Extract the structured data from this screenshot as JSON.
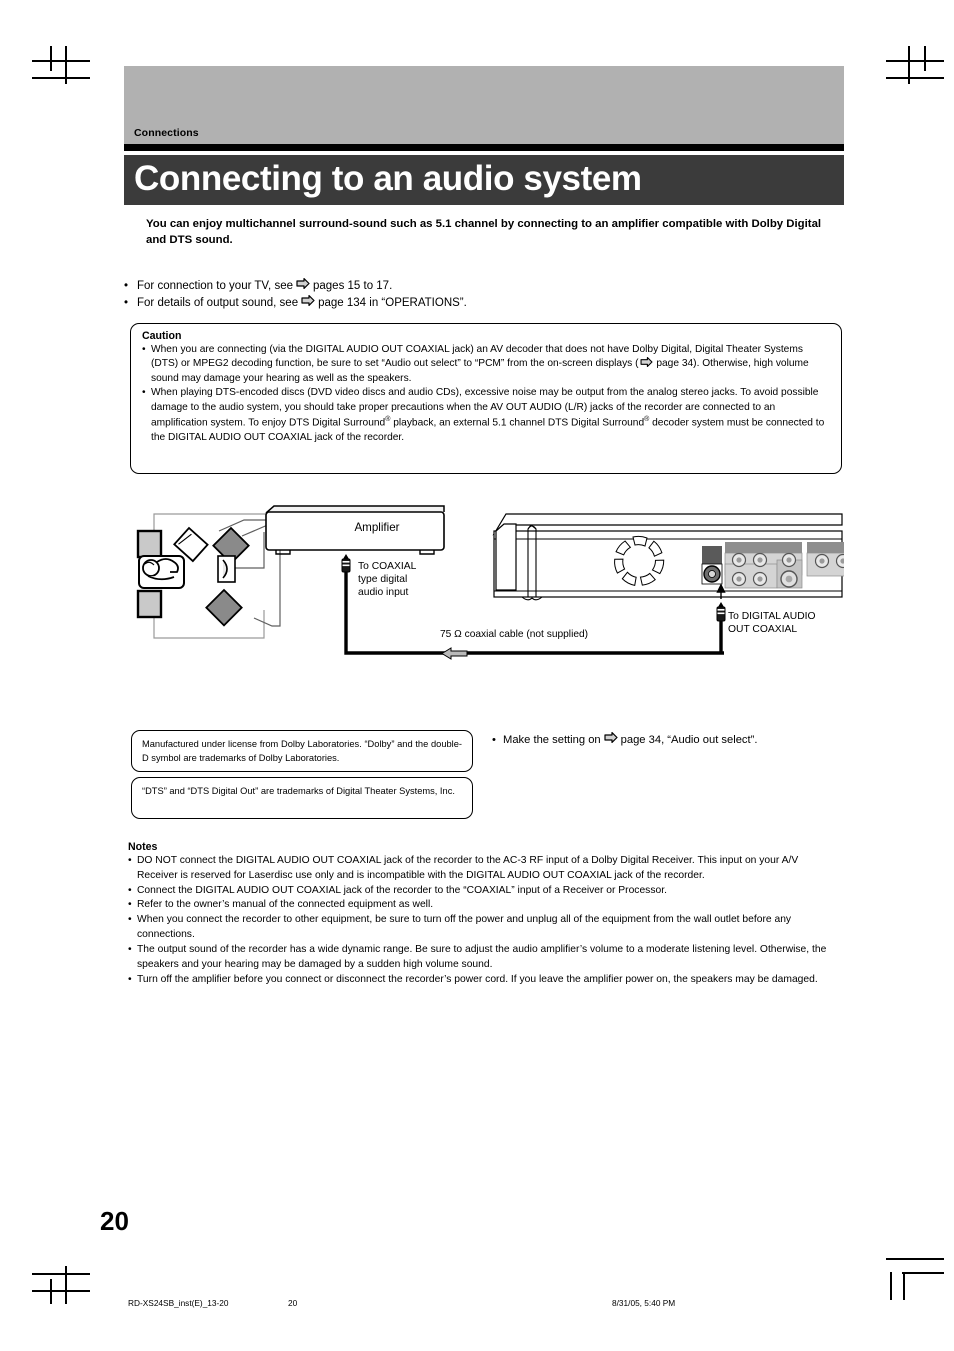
{
  "header": {
    "section_label": "Connections",
    "title": "Connecting to an audio system"
  },
  "intro": "You can enjoy multichannel surround-sound such as 5.1 channel by connecting to an amplifier compatible with Dolby Digital and DTS sound.",
  "see_also": [
    {
      "bullet": "•",
      "before": "For connection to your TV, see",
      "after": "pages 15 to 17."
    },
    {
      "bullet": "•",
      "before": "For details of output sound, see",
      "after": "page 134 in “OPERATIONS”."
    }
  ],
  "caution": {
    "heading": "Caution",
    "items": [
      {
        "bullet": "•",
        "part1": "When you are connecting (via the DIGITAL AUDIO OUT COAXIAL jack) an AV decoder that does not have Dolby Digital, Digital Theater Systems (DTS) or MPEG2 decoding function, be sure to set “Audio out select” to “PCM” from the on-screen displays (",
        "part2": " page 34). Otherwise, high volume sound may damage your hearing as well as the speakers."
      },
      {
        "bullet": "•",
        "part1": "When playing DTS-encoded discs (DVD video discs and audio CDs), excessive noise may be output from the analog stereo jacks.  To avoid possible damage to the audio system, you should take proper precautions when the AV OUT AUDIO (L/R) jacks of the recorder are connected to an amplification system.  To enjoy DTS Digital Surround® playback, an external 5.1 channel DTS Digital Surround® decoder system must be connected to the DIGITAL AUDIO OUT COAXIAL jack of the recorder.",
        "part2": ""
      }
    ]
  },
  "diagram": {
    "amplifier_label": "Amplifier",
    "coaxial_input_label": "To COAXIAL\ntype digital\naudio input",
    "cable_label": "75 Ω coaxial cable (not supplied)",
    "digital_out_label": "To DIGITAL AUDIO\nOUT COAXIAL"
  },
  "trademarks": [
    "Manufactured under license from Dolby Laboratories. “Dolby” and the double-D symbol are trademarks of Dolby Laboratories.",
    "“DTS” and “DTS Digital Out” are trademarks of Digital Theater Systems, Inc."
  ],
  "make_setting": {
    "bullet": "•",
    "before": "Make the setting on",
    "after": "page 34, “Audio out select”."
  },
  "notes": {
    "heading": "Notes",
    "items": [
      {
        "bullet": "•",
        "text": "DO NOT connect the DIGITAL AUDIO OUT COAXIAL jack of the recorder to the AC-3 RF input of a Dolby Digital Receiver. This input on your A/V Receiver is reserved for Laserdisc use only and is incompatible with the DIGITAL AUDIO OUT COAXIAL jack of the recorder."
      },
      {
        "bullet": "•",
        "text": "Connect the DIGITAL AUDIO OUT COAXIAL jack of the recorder to the “COAXIAL” input of a Receiver or Processor."
      },
      {
        "bullet": "•",
        "text": "Refer to the owner’s manual of the connected equipment as well."
      },
      {
        "bullet": "•",
        "text": "When you connect the recorder to other equipment, be sure to turn off the power and unplug all of the equipment from the wall outlet before any connections."
      },
      {
        "bullet": "•",
        "text": "The output sound of the recorder has a wide dynamic range. Be sure to adjust the audio amplifier’s volume to a moderate listening level. Otherwise, the speakers and your hearing may be damaged by a sudden high volume sound."
      },
      {
        "bullet": "•",
        "text": "Turn off the amplifier before you connect or disconnect the recorder’s power cord. If you leave the amplifier power on, the speakers may be damaged."
      }
    ]
  },
  "page_number": "20",
  "footer": {
    "file": "RD-XS24SB_inst(E)_13-20",
    "page": "20",
    "timestamp": "8/31/05, 5:40 PM"
  },
  "colors": {
    "gray_band": "#b1b1b1",
    "title_bar": "#3b3b3b",
    "rule": "#000000"
  }
}
